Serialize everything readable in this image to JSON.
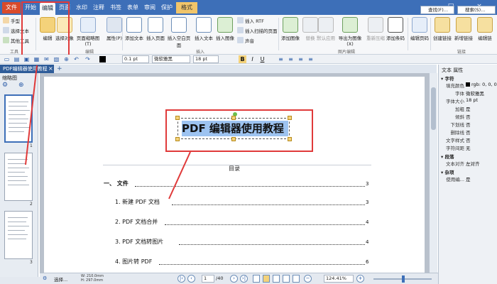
{
  "menu": {
    "file": "文件",
    "tabs": [
      "开始",
      "编辑",
      "页面",
      "水印",
      "注释",
      "书签",
      "表单",
      "审阅",
      "保护"
    ],
    "active_tab": "编辑",
    "format_tab": "格式",
    "find": "查找(F)...",
    "search": "搜索(S)...",
    "window_controls": [
      "-",
      "□",
      "×"
    ]
  },
  "ribbon": {
    "tools_group": {
      "label": "工具",
      "items": [
        "手型",
        "选择文本",
        "其他工具"
      ]
    },
    "edit_group": {
      "label": "编辑",
      "edit_btn": "编辑",
      "select_obj_btn": "选择对象",
      "page_thumb_btn": "页面缩略图(T)",
      "properties_btn": "属性(P)"
    },
    "insert_group": {
      "label": "插入",
      "items": [
        "添加文本",
        "插入页面",
        "插入空白页面",
        "插入文本",
        "插入图像"
      ],
      "small_items": [
        "插入 RTF",
        "插入扫描的页面",
        "声音"
      ]
    },
    "image_group": {
      "label": "图片编辑",
      "items": [
        "添加图像",
        "替换",
        "默认应用",
        "导出为图像(X)",
        "重新压缩",
        "添加条码"
      ]
    },
    "page_label": "编辑页码",
    "link_group": {
      "label": "链接",
      "items": [
        "创建链接",
        "新增链接",
        "编辑链"
      ]
    }
  },
  "toolbar": {
    "line_width": "0.1 pt",
    "font_name": "微软雅黑",
    "font_size": "18 pt",
    "bold": "B",
    "italic": "I",
    "underline": "U"
  },
  "doc_tab": {
    "title": "PDF编辑器使用教程",
    "close": "×",
    "add": "+"
  },
  "thumbnails": {
    "title": "缩略图",
    "pages": [
      "1",
      "2",
      "3"
    ]
  },
  "document": {
    "heading": "PDF 编辑器使用教程",
    "toc_title": "目录",
    "toc": [
      {
        "label": "一、 文件",
        "page": "3"
      },
      {
        "label": "1. 新建 PDF 文档",
        "page": "3"
      },
      {
        "label": "2. PDF 文档合并",
        "page": "4"
      },
      {
        "label": "3. PDF 文档转图片",
        "page": "4"
      },
      {
        "label": "4. 图片转 PDF",
        "page": "6"
      }
    ]
  },
  "properties": {
    "title": "文本 属性",
    "section_char": "字符",
    "rows": [
      {
        "label": "填充颜色",
        "value": "rgb: 0, 0, 0"
      },
      {
        "label": "字体",
        "value": "微软雅黑"
      },
      {
        "label": "字体大小",
        "value": "18 pt"
      },
      {
        "label": "加粗",
        "value": "是"
      },
      {
        "label": "倾斜",
        "value": "否"
      },
      {
        "label": "下划线",
        "value": "否"
      },
      {
        "label": "删除线",
        "value": "否"
      },
      {
        "label": "文字样式",
        "value": "否"
      },
      {
        "label": "字符间距",
        "value": "无"
      }
    ],
    "section_para": "段落",
    "para_rows": [
      {
        "label": "文本对齐",
        "value": "左对齐"
      }
    ],
    "section_misc": "杂项",
    "misc_rows": [
      {
        "label": "使用编...",
        "value": "是"
      }
    ]
  },
  "status": {
    "select_label": "选择...",
    "dims_w": "W: 210.0mm",
    "dims_h": "H: 297.0mm",
    "page_current": "1",
    "page_total": "/40",
    "zoom": "124.41%"
  },
  "colors": {
    "menubar": "#3d6fb8",
    "file_tab": "#d94a2b",
    "format_tab": "#f1c56a",
    "highlight": "#e03a3a",
    "selection": "#9dc3f0"
  }
}
